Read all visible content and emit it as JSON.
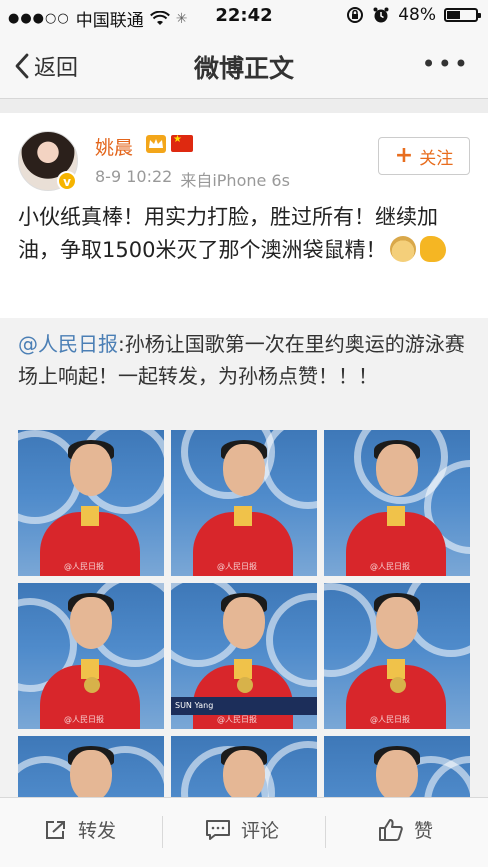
{
  "status_bar": {
    "carrier": "中国联通",
    "time": "22:42",
    "battery": "48%",
    "battery_level": 0.48
  },
  "nav": {
    "back_label": "返回",
    "title": "微博正文"
  },
  "post": {
    "username": "姚晨",
    "date": "8-9 10:22",
    "source": "来自iPhone 6s",
    "follow_label": "关注",
    "text": "小伙纸真棒！用实力打脸，胜过所有！继续加油，争取1500米灭了那个澳洲袋鼠精！"
  },
  "repost": {
    "mention": "@人民日报",
    "text": ":孙杨让国歌第一次在里约奥运的游泳赛场上响起！一起转发，为孙杨点赞！！！",
    "watermark": "@人民日报",
    "caption": "SUN Yang"
  },
  "actions": {
    "repost_label": "转发",
    "comment_label": "评论",
    "like_label": "赞"
  },
  "colors": {
    "username": "#e3651b",
    "mention": "#4b7fb5",
    "follow": "#e86d1e"
  }
}
